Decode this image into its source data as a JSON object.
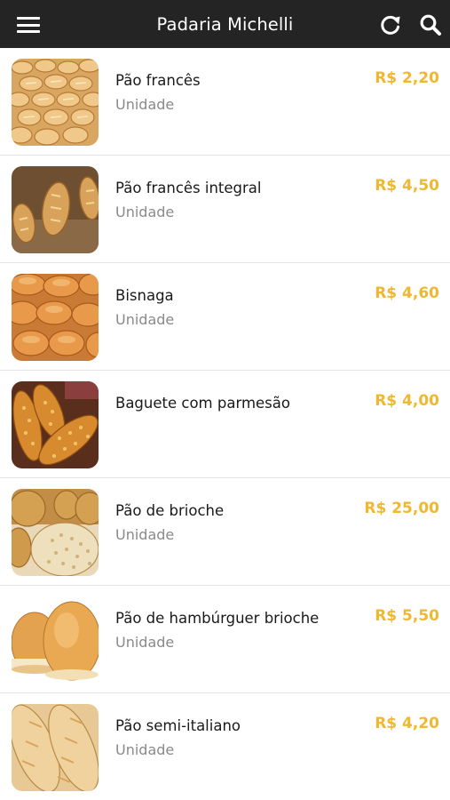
{
  "app": {
    "title": "Padaria Michelli",
    "accent_color": "#f0b730",
    "header_bg": "#242424",
    "icons": {
      "menu": "hamburger-menu-icon",
      "refresh": "refresh-icon",
      "search": "search-icon"
    }
  },
  "products": [
    {
      "name": "Pão francês",
      "unit": "Unidade",
      "price": "R$ 2,20"
    },
    {
      "name": "Pão francês integral",
      "unit": "Unidade",
      "price": "R$ 4,50"
    },
    {
      "name": "Bisnaga",
      "unit": "Unidade",
      "price": "R$ 4,60"
    },
    {
      "name": "Baguete com parmesão",
      "unit": "",
      "price": "R$ 4,00"
    },
    {
      "name": "Pão de brioche",
      "unit": "Unidade",
      "price": "R$ 25,00"
    },
    {
      "name": "Pão de hambúrguer brioche",
      "unit": "Unidade",
      "price": "R$ 5,50"
    },
    {
      "name": "Pão semi-italiano",
      "unit": "Unidade",
      "price": "R$ 4,20"
    }
  ]
}
